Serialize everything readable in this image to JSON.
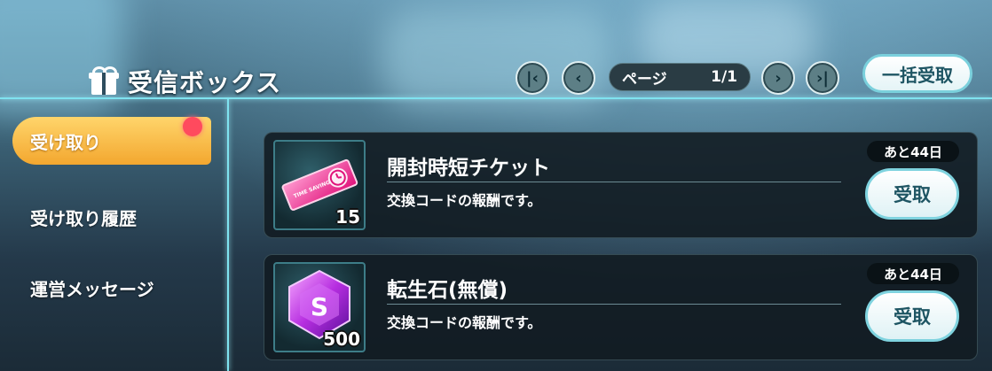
{
  "header": {
    "title": "受信ボックス"
  },
  "pagination": {
    "first_symbol": "|‹",
    "prev_symbol": "‹",
    "next_symbol": "›",
    "last_symbol": "›|",
    "page_label": "ページ",
    "page_value": "1/1"
  },
  "bulk_claim_label": "一括受取",
  "sidebar": {
    "items": [
      {
        "label": "受け取り",
        "active": true,
        "has_notification": true
      },
      {
        "label": "受け取り履歴",
        "active": false
      },
      {
        "label": "運営メッセージ",
        "active": false
      }
    ]
  },
  "rewards": [
    {
      "name": "開封時短チケット",
      "description": "交換コードの報酬です。",
      "quantity": "15",
      "remaining": "あと44日",
      "claim_label": "受取",
      "icon": "time-shortening-ticket-icon",
      "ticket_text": "TIME SAVING"
    },
    {
      "name": "転生石(無償)",
      "description": "交換コードの報酬です。",
      "quantity": "500",
      "remaining": "あと44日",
      "claim_label": "受取",
      "icon": "reincarnation-stone-icon",
      "stone_glyph": "S"
    }
  ],
  "colors": {
    "accent": "#7fd3df",
    "active_tab": "#f3a72f",
    "notification": "#ff4a5e"
  }
}
